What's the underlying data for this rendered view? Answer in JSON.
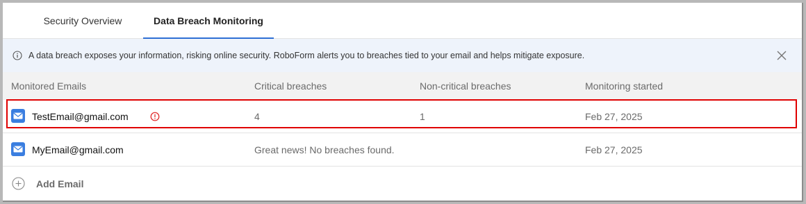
{
  "tabs": [
    {
      "label": "Security Overview",
      "active": false
    },
    {
      "label": "Data Breach Monitoring",
      "active": true
    }
  ],
  "banner": {
    "icon": "info-icon",
    "text": "A data breach exposes your information, risking online security. RoboForm alerts you to breaches tied to your email and helps mitigate exposure.",
    "close_icon": "close-icon"
  },
  "table": {
    "headers": [
      "Monitored Emails",
      "Critical breaches",
      "Non-critical breaches",
      "Monitoring started"
    ],
    "rows": [
      {
        "email": "TestEmail@gmail.com",
        "alert": true,
        "critical": "4",
        "non_critical": "1",
        "started": "Feb 27, 2025",
        "highlighted": true
      },
      {
        "email": "MyEmail@gmail.com",
        "alert": false,
        "status": "Great news! No breaches found.",
        "started": "Feb 27, 2025",
        "highlighted": false
      }
    ]
  },
  "add_email": {
    "label": "Add Email",
    "icon": "plus-circle-icon"
  },
  "colors": {
    "accent": "#2f6fd4",
    "banner_bg": "#eef3fb",
    "header_bg": "#f2f2f2",
    "highlight": "#e00000",
    "alert": "#e02020",
    "mail_icon": "#3a7ee0"
  }
}
